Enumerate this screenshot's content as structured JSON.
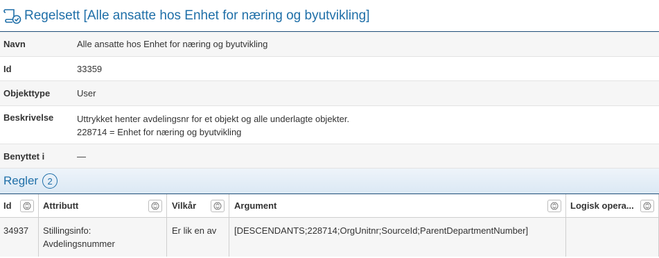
{
  "header": {
    "icon": "ruleset-check-icon",
    "title": "Regelsett [Alle ansatte hos Enhet for næring og byutvikling]"
  },
  "properties": {
    "name_label": "Navn",
    "name_value": "Alle ansatte hos Enhet for næring og byutvikling",
    "id_label": "Id",
    "id_value": "33359",
    "type_label": "Objekttype",
    "type_value": "User",
    "desc_label": "Beskrivelse",
    "desc_line1": "Uttrykket henter avdelingsnr for et objekt og alle underlagte objekter.",
    "desc_line2": "228714 =  Enhet for næring og byutvikling",
    "used_label": "Benyttet i",
    "used_value": "—"
  },
  "rules": {
    "title": "Regler",
    "count": "2",
    "columns": {
      "id": "Id",
      "attribute": "Attributt",
      "operator": "Vilkår",
      "argument": "Argument",
      "logic": "Logisk opera..."
    },
    "rows": [
      {
        "id": "34937",
        "attribute_line1": "Stillingsinfo:",
        "attribute_line2": "Avdelingsnummer",
        "operator": "Er lik en av",
        "argument": "[DESCENDANTS;228714;OrgUnitnr;SourceId;ParentDepartmentNumber]",
        "logic": ""
      }
    ]
  },
  "colors": {
    "accent": "#1f6fa8",
    "rule_line": "#1f4e79",
    "row_alt": "#f6f6f6"
  }
}
